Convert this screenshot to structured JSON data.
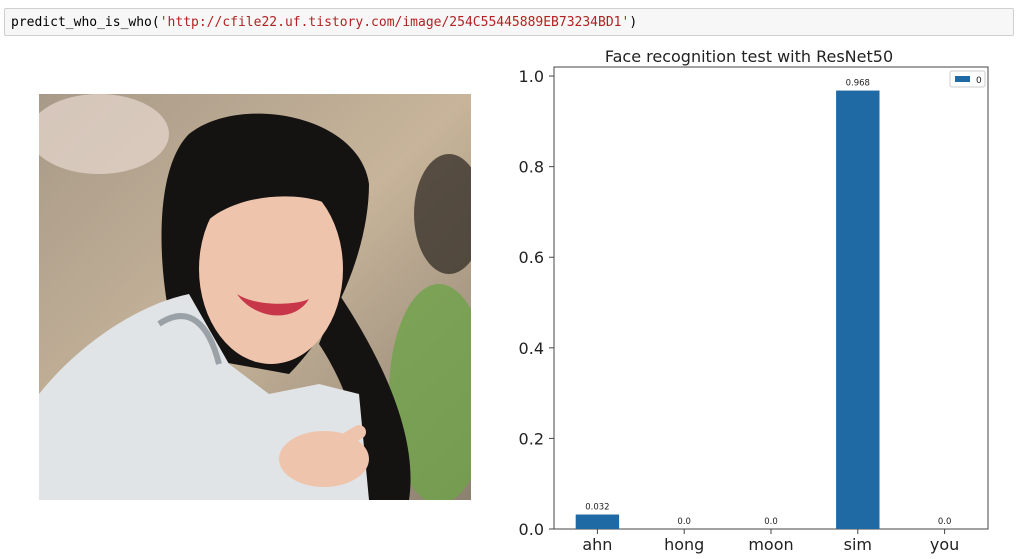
{
  "code_cell": {
    "fn": "predict_who_is_who(",
    "arg": "'http://cfile22.uf.tistory.com/image/254C55445889EB73234BD1'",
    "close": ")"
  },
  "image": {
    "description_icon": "portrait-photo-icon"
  },
  "chart_data": {
    "type": "bar",
    "title": "Face recognition test with ResNet50",
    "categories": [
      "ahn",
      "hong",
      "moon",
      "sim",
      "you"
    ],
    "series": [
      {
        "name": "0",
        "values": [
          0.032,
          0.0,
          0.0,
          0.968,
          0.0
        ],
        "labels": [
          "0.032",
          "0.0",
          "0.0",
          "0.968",
          "0.0"
        ],
        "color": "#1f6aa5"
      }
    ],
    "ylim": [
      0,
      1.02
    ],
    "yticks": [
      0.0,
      0.2,
      0.4,
      0.6,
      0.8,
      1.0
    ],
    "ytick_labels": [
      "0.0",
      "0.2",
      "0.4",
      "0.6",
      "0.8",
      "1.0"
    ],
    "xlabel": "",
    "ylabel": "",
    "legend": "top-right",
    "grid": false
  }
}
